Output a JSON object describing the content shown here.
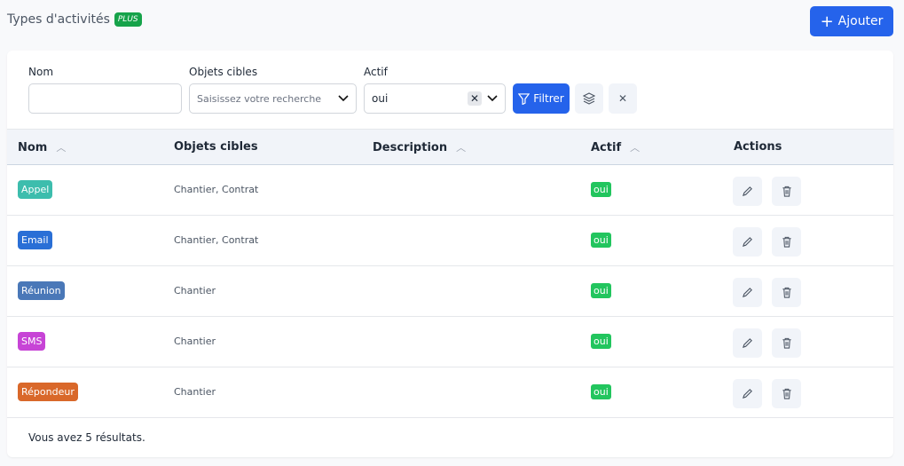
{
  "header": {
    "title": "Types d'activités",
    "plan_badge": "PLUS",
    "add_label": "Ajouter"
  },
  "filters": {
    "nom_label": "Nom",
    "nom_value": "",
    "objets_label": "Objets cibles",
    "objets_placeholder": "Saisissez votre recherche",
    "actif_label": "Actif",
    "actif_value": "oui",
    "filter_label": "Filtrer"
  },
  "table": {
    "columns": [
      "Nom",
      "Objets cibles",
      "Description",
      "Actif",
      "Actions"
    ],
    "rows": [
      {
        "nom": "Appel",
        "color": "#3dbdad",
        "objets": "Chantier, Contrat",
        "description": "",
        "actif": "oui"
      },
      {
        "nom": "Email",
        "color": "#2a6fd6",
        "objets": "Chantier, Contrat",
        "description": "",
        "actif": "oui"
      },
      {
        "nom": "Réunion",
        "color": "#4a78b8",
        "objets": "Chantier",
        "description": "",
        "actif": "oui"
      },
      {
        "nom": "SMS",
        "color": "#c744d6",
        "objets": "Chantier",
        "description": "",
        "actif": "oui"
      },
      {
        "nom": "Répondeur",
        "color": "#d9682a",
        "objets": "Chantier",
        "description": "",
        "actif": "oui"
      }
    ]
  },
  "footer": {
    "results": "Vous avez 5 résultats."
  }
}
